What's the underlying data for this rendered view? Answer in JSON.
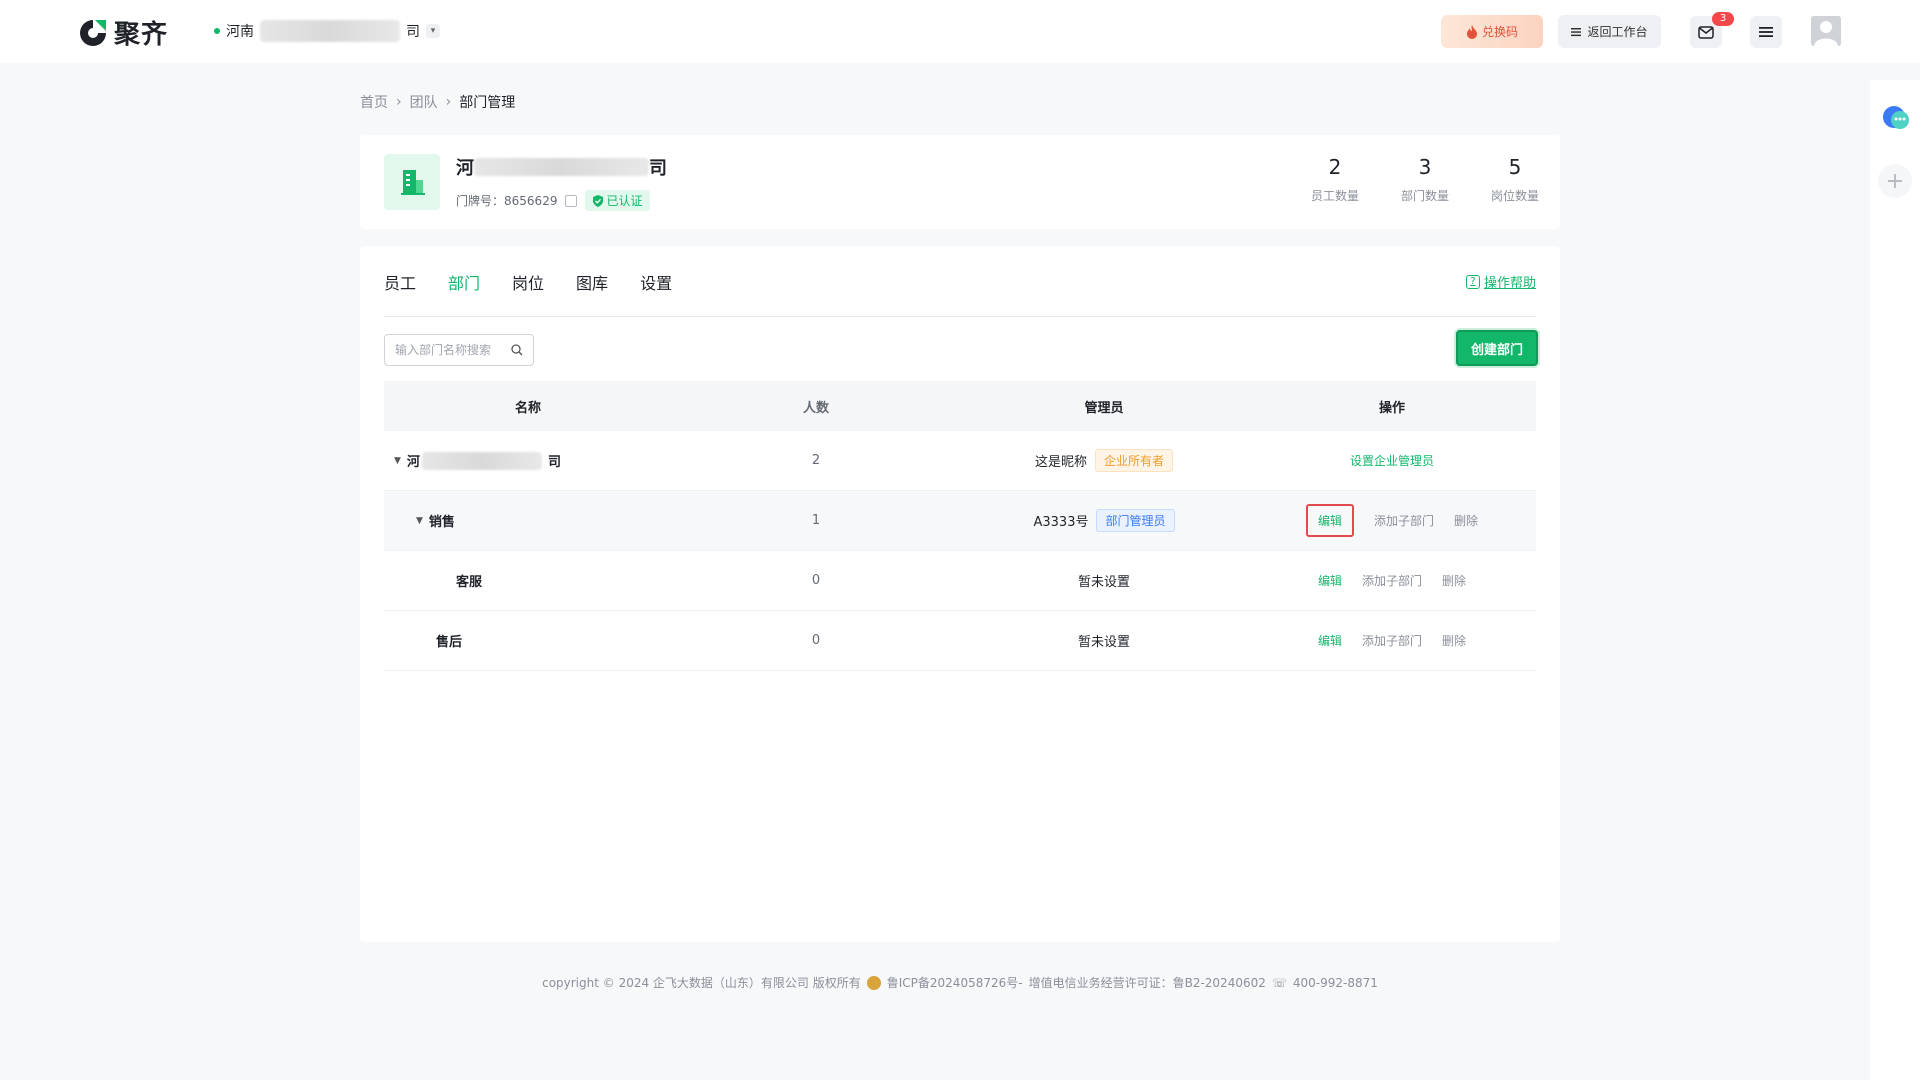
{
  "app": {
    "name": "聚齐"
  },
  "header": {
    "company_prefix": "河南",
    "company_suffix": "司",
    "redeem_label": "兑换码",
    "back_label": "返回工作台",
    "mail_badge": "3"
  },
  "breadcrumb": [
    "首页",
    "团队",
    "部门管理"
  ],
  "company": {
    "name_prefix": "河",
    "name_suffix": "司",
    "doorplate_label": "门牌号：",
    "doorplate_value": "8656629",
    "verified_label": "已认证",
    "stats": [
      {
        "value": "2",
        "label": "员工数量"
      },
      {
        "value": "3",
        "label": "部门数量"
      },
      {
        "value": "5",
        "label": "岗位数量"
      }
    ]
  },
  "tabs": [
    "员工",
    "部门",
    "岗位",
    "图库",
    "设置"
  ],
  "active_tab": "部门",
  "help_label": "操作帮助",
  "search": {
    "placeholder": "输入部门名称搜索"
  },
  "create_label": "创建部门",
  "table": {
    "headers": [
      "名称",
      "人数",
      "管理员",
      "操作"
    ],
    "rows": [
      {
        "name_prefix": "河",
        "name_suffix": "司",
        "count": "2",
        "admin": "这是昵称",
        "admin_tag": "企业所有者",
        "op_main": "设置企业管理员"
      },
      {
        "name": "销售",
        "count": "1",
        "admin": "A3333号",
        "admin_tag": "部门管理员",
        "ops": [
          "编辑",
          "添加子部门",
          "删除"
        ]
      },
      {
        "name": "客服",
        "count": "0",
        "admin": "暂未设置",
        "ops": [
          "编辑",
          "添加子部门",
          "删除"
        ]
      },
      {
        "name": "售后",
        "count": "0",
        "admin": "暂未设置",
        "ops": [
          "编辑",
          "添加子部门",
          "删除"
        ]
      }
    ]
  },
  "footer": {
    "copyright": "copyright © 2024 企飞大数据（山东）有限公司 版权所有",
    "icp": "鲁ICP备2024058726号-",
    "license": "增值电信业务经营许可证：鲁B2-20240602",
    "phone": "400-992-8871"
  },
  "colors": {
    "accent": "#12b76a",
    "highlight": "#e5484d"
  }
}
